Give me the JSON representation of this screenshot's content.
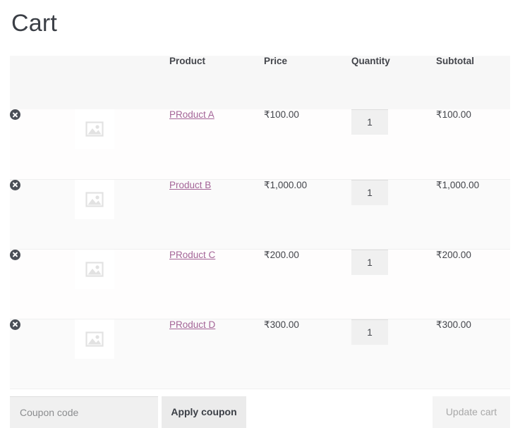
{
  "page": {
    "title": "Cart"
  },
  "cart_table": {
    "columns": [
      {
        "key": "remove",
        "label": ""
      },
      {
        "key": "thumbnail",
        "label": ""
      },
      {
        "key": "product",
        "label": "Product"
      },
      {
        "key": "price",
        "label": "Price"
      },
      {
        "key": "quantity",
        "label": "Quantity"
      },
      {
        "key": "subtotal",
        "label": "Subtotal"
      }
    ],
    "rows": [
      {
        "remove_label": "×",
        "thumbnail_icon": "image-placeholder-icon",
        "product_name": "PRoduct A",
        "price": "₹100.00",
        "quantity": "1",
        "subtotal": "₹100.00"
      },
      {
        "remove_label": "×",
        "thumbnail_icon": "image-placeholder-icon",
        "product_name": "Product B",
        "price": "₹1,000.00",
        "quantity": "1",
        "subtotal": "₹1,000.00"
      },
      {
        "remove_label": "×",
        "thumbnail_icon": "image-placeholder-icon",
        "product_name": "PRoduct C",
        "price": "₹200.00",
        "quantity": "1",
        "subtotal": "₹200.00"
      },
      {
        "remove_label": "×",
        "thumbnail_icon": "image-placeholder-icon",
        "product_name": "PRoduct D",
        "price": "₹300.00",
        "quantity": "1",
        "subtotal": "₹300.00"
      }
    ]
  },
  "actions": {
    "coupon_placeholder": "Coupon code",
    "coupon_value": "",
    "apply_coupon_label": "Apply coupon",
    "update_cart_label": "Update cart"
  },
  "colors": {
    "link": "#a46497",
    "text": "#43454b",
    "header_bg": "#f7f7f7",
    "row_alt_bg": "#fafafa",
    "input_bg": "#f0f0f0",
    "button_bg": "#ebebeb",
    "disabled_text": "#a8a8a8",
    "remove_icon_bg": "#4a4f57"
  }
}
